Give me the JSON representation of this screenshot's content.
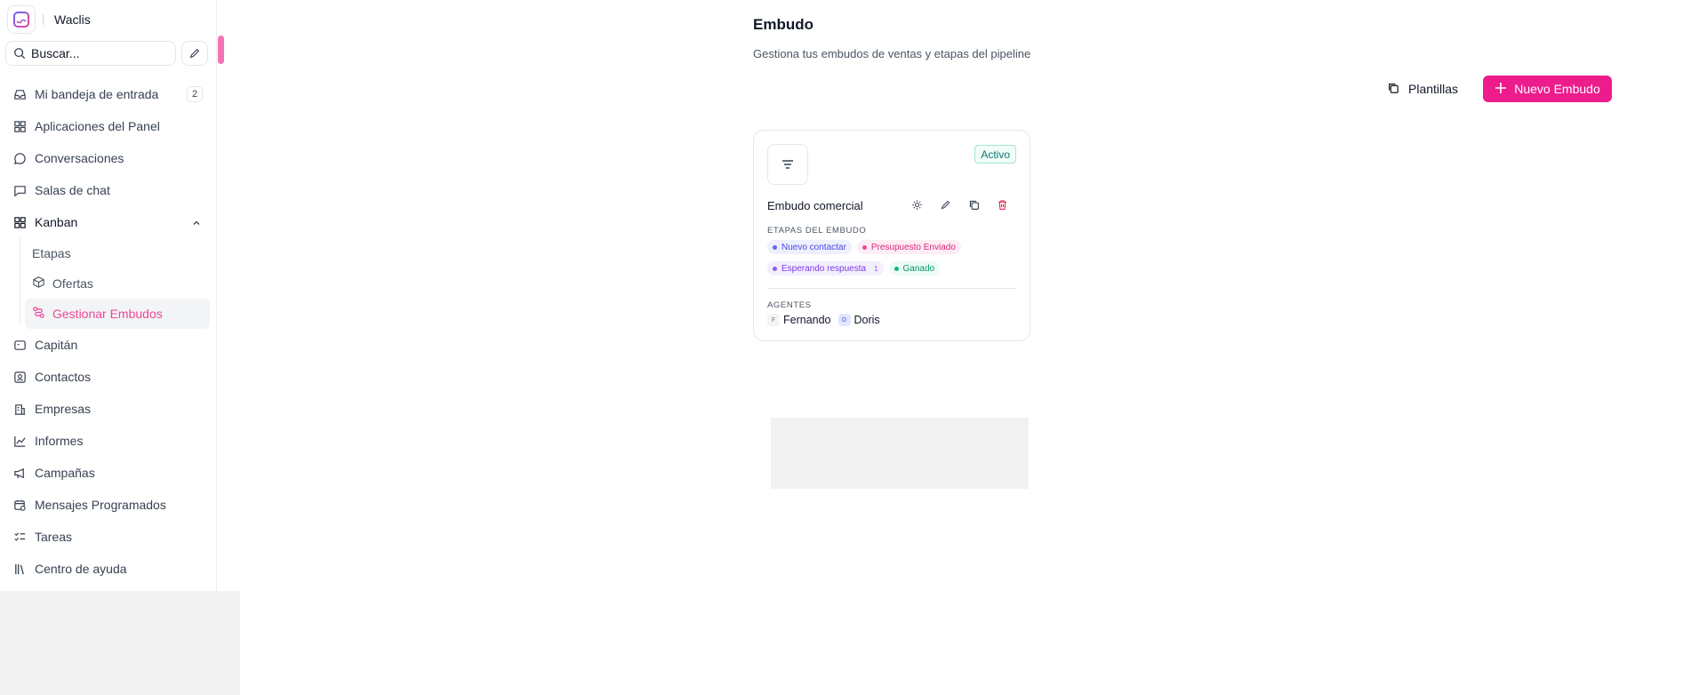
{
  "brand": {
    "name": "Waclis"
  },
  "search": {
    "placeholder": "Buscar..."
  },
  "nav": {
    "inbox": {
      "label": "Mi bandeja de entrada",
      "badge": "2"
    },
    "apps": "Aplicaciones del Panel",
    "conversations": "Conversaciones",
    "chat_rooms": "Salas de chat",
    "kanban": "Kanban",
    "kanban_sub": {
      "stages": "Etapas",
      "offers": "Ofertas",
      "manage": "Gestionar Embudos"
    },
    "captain": "Capitán",
    "contacts": "Contactos",
    "companies": "Empresas",
    "reports": "Informes",
    "campaigns": "Campañas",
    "scheduled": "Mensajes Programados",
    "tasks": "Tareas",
    "help": "Centro de ayuda"
  },
  "header": {
    "title": "Embudo",
    "subtitle": "Gestiona tus embudos de ventas y etapas del pipeline",
    "templates_label": "Plantillas",
    "new_label": "Nuevo Embudo"
  },
  "card": {
    "name": "Embudo comercial",
    "status": "Activo",
    "stages_label": "ETAPAS DEL EMBUDO",
    "stages": [
      {
        "label": "Nuevo contactar",
        "color": "#6366f1",
        "bg": "#eef0fd",
        "text": "#4f46e5"
      },
      {
        "label": "Presupuesto Enviado",
        "color": "#ec4899",
        "bg": "#fdeef6",
        "text": "#db2777"
      },
      {
        "label": "Esperando respuesta",
        "count": "1",
        "color": "#8b5cf6",
        "bg": "#f3effd",
        "text": "#7c3aed"
      },
      {
        "label": "Ganado",
        "color": "#10b981",
        "bg": "#ecfbf4",
        "text": "#059669"
      }
    ],
    "agents_label": "AGENTES",
    "agents": [
      {
        "initial": "F",
        "name": "Fernando"
      },
      {
        "initial": "D",
        "name": "Doris"
      }
    ]
  },
  "colors": {
    "accent": "#ec1c8c",
    "active_nav": "#ec4899"
  }
}
